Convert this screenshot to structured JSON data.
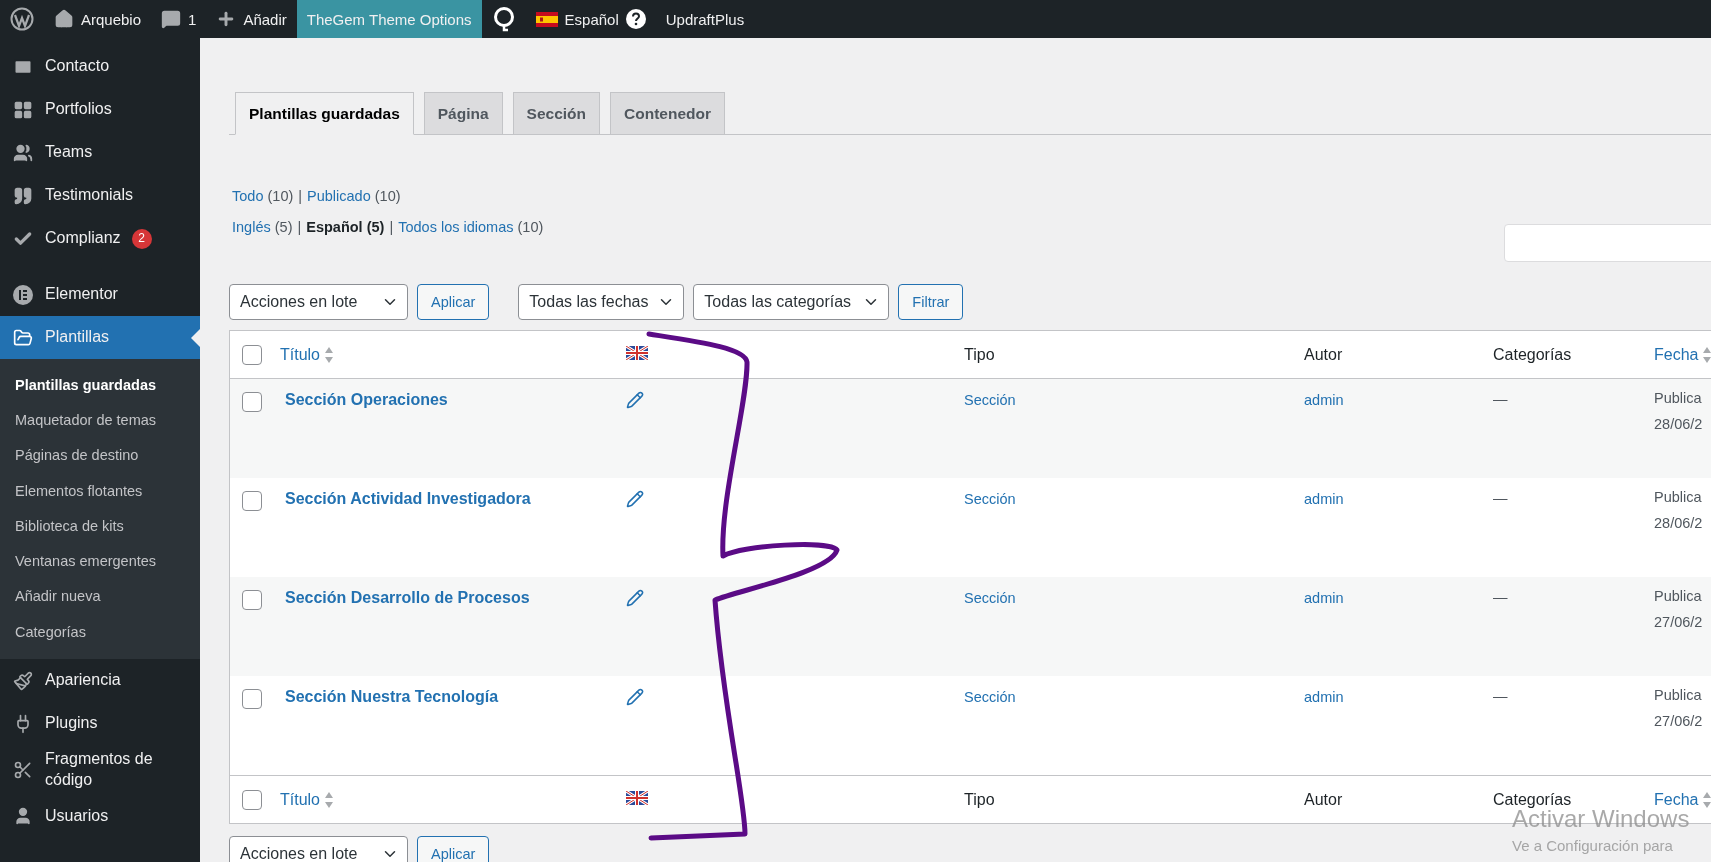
{
  "admin_bar": [
    {
      "kind": "wp-logo",
      "highlighted": false
    },
    {
      "kind": "site",
      "label": "Arquebio",
      "highlighted": false
    },
    {
      "kind": "comments",
      "label": "1",
      "highlighted": false
    },
    {
      "kind": "new",
      "label": "Añadir",
      "highlighted": false
    },
    {
      "kind": "text",
      "label": "TheGem Theme Options",
      "highlighted": true
    },
    {
      "kind": "seo",
      "highlighted": false
    },
    {
      "kind": "language",
      "label": "Español",
      "highlighted": false
    },
    {
      "kind": "text",
      "label": "UpdraftPlus",
      "highlighted": false
    }
  ],
  "sidebar": {
    "items": [
      {
        "label": "Contacto",
        "selected": false
      },
      {
        "label": "Portfolios",
        "selected": false
      },
      {
        "label": "Teams",
        "selected": false
      },
      {
        "label": "Testimonials",
        "selected": false
      },
      {
        "label": "Complianz",
        "badge": "2",
        "selected": false
      },
      {
        "kind": "separator"
      },
      {
        "label": "Elementor",
        "selected": false
      },
      {
        "label": "Plantillas",
        "selected": true,
        "children": [
          {
            "label": "Plantillas guardadas",
            "selected": true
          },
          {
            "label": "Maquetador de temas",
            "selected": false
          },
          {
            "label": "Páginas de destino",
            "selected": false
          },
          {
            "label": "Elementos flotantes",
            "selected": false
          },
          {
            "label": "Biblioteca de kits",
            "selected": false
          },
          {
            "label": "Ventanas emergentes",
            "selected": false
          },
          {
            "label": "Añadir nueva",
            "selected": false
          },
          {
            "label": "Categorías",
            "selected": false
          }
        ]
      },
      {
        "label": "Apariencia",
        "selected": false
      },
      {
        "label": "Plugins",
        "selected": false
      },
      {
        "label": "Fragmentos de código",
        "selected": false
      },
      {
        "label": "Usuarios",
        "selected": false
      }
    ]
  },
  "tabs": [
    {
      "label": "Plantillas guardadas",
      "selected": true
    },
    {
      "label": "Página",
      "selected": false
    },
    {
      "label": "Sección",
      "selected": false
    },
    {
      "label": "Contenedor",
      "selected": false
    }
  ],
  "views": [
    [
      {
        "kind": "view",
        "label": "Todo",
        "count": "(10)",
        "current": false
      },
      {
        "kind": "separator",
        "text": "|"
      },
      {
        "kind": "view",
        "label": "Publicado",
        "count": "(10)",
        "current": false
      }
    ],
    [
      {
        "kind": "view",
        "label": "Inglés",
        "count": "(5)",
        "current": false
      },
      {
        "kind": "separator",
        "text": "|"
      },
      {
        "kind": "view",
        "label": "Español",
        "count": "(5)",
        "current": true
      },
      {
        "kind": "separator",
        "text": "|"
      },
      {
        "kind": "view",
        "label": "Todos los idiomas",
        "count": "(10)",
        "current": false
      }
    ]
  ],
  "search": {
    "kind": "field"
  },
  "top_nav": {
    "bulk_select": "Acciones en lote",
    "apply": "Aplicar",
    "date_select": "Todas las fechas",
    "category_select": "Todas las categorías",
    "filter": "Filtrar"
  },
  "table": {
    "header_columns": [
      {
        "kind": "checkbox",
        "checked": false
      },
      {
        "kind": "sortable",
        "label": "Título"
      },
      {
        "kind": "flag"
      },
      {
        "kind": "plain",
        "label": "Tipo"
      },
      {
        "kind": "plain",
        "label": "Autor"
      },
      {
        "kind": "plain",
        "label": "Categorías"
      },
      {
        "kind": "sortable",
        "label": "Fecha"
      }
    ],
    "rows": [
      {
        "checked": false,
        "title": "Sección Operaciones",
        "type": "Sección",
        "author": "admin",
        "categories": "—",
        "status": "Publica",
        "date": "28/06/2"
      },
      {
        "checked": false,
        "title": "Sección Actividad Investigadora",
        "type": "Sección",
        "author": "admin",
        "categories": "—",
        "status": "Publica",
        "date": "28/06/2"
      },
      {
        "checked": false,
        "title": "Sección Desarrollo de Procesos",
        "type": "Sección",
        "author": "admin",
        "categories": "—",
        "status": "Publica",
        "date": "27/06/2"
      },
      {
        "checked": false,
        "title": "Sección Nuestra Tecnología",
        "type": "Sección",
        "author": "admin",
        "categories": "—",
        "status": "Publica",
        "date": "27/06/2"
      }
    ],
    "footer_columns": [
      {
        "kind": "checkbox",
        "checked": false
      },
      {
        "kind": "sortable",
        "label": "Título"
      },
      {
        "kind": "flag"
      },
      {
        "kind": "plain",
        "label": "Tipo"
      },
      {
        "kind": "plain",
        "label": "Autor"
      },
      {
        "kind": "plain",
        "label": "Categorías"
      },
      {
        "kind": "sortable",
        "label": "Fecha"
      }
    ]
  },
  "bottom_nav": {
    "bulk_select": "Acciones en lote",
    "apply": "Aplicar"
  },
  "os_notice": {
    "title": "Activar Windows",
    "text": "Ve a Configuración para"
  }
}
